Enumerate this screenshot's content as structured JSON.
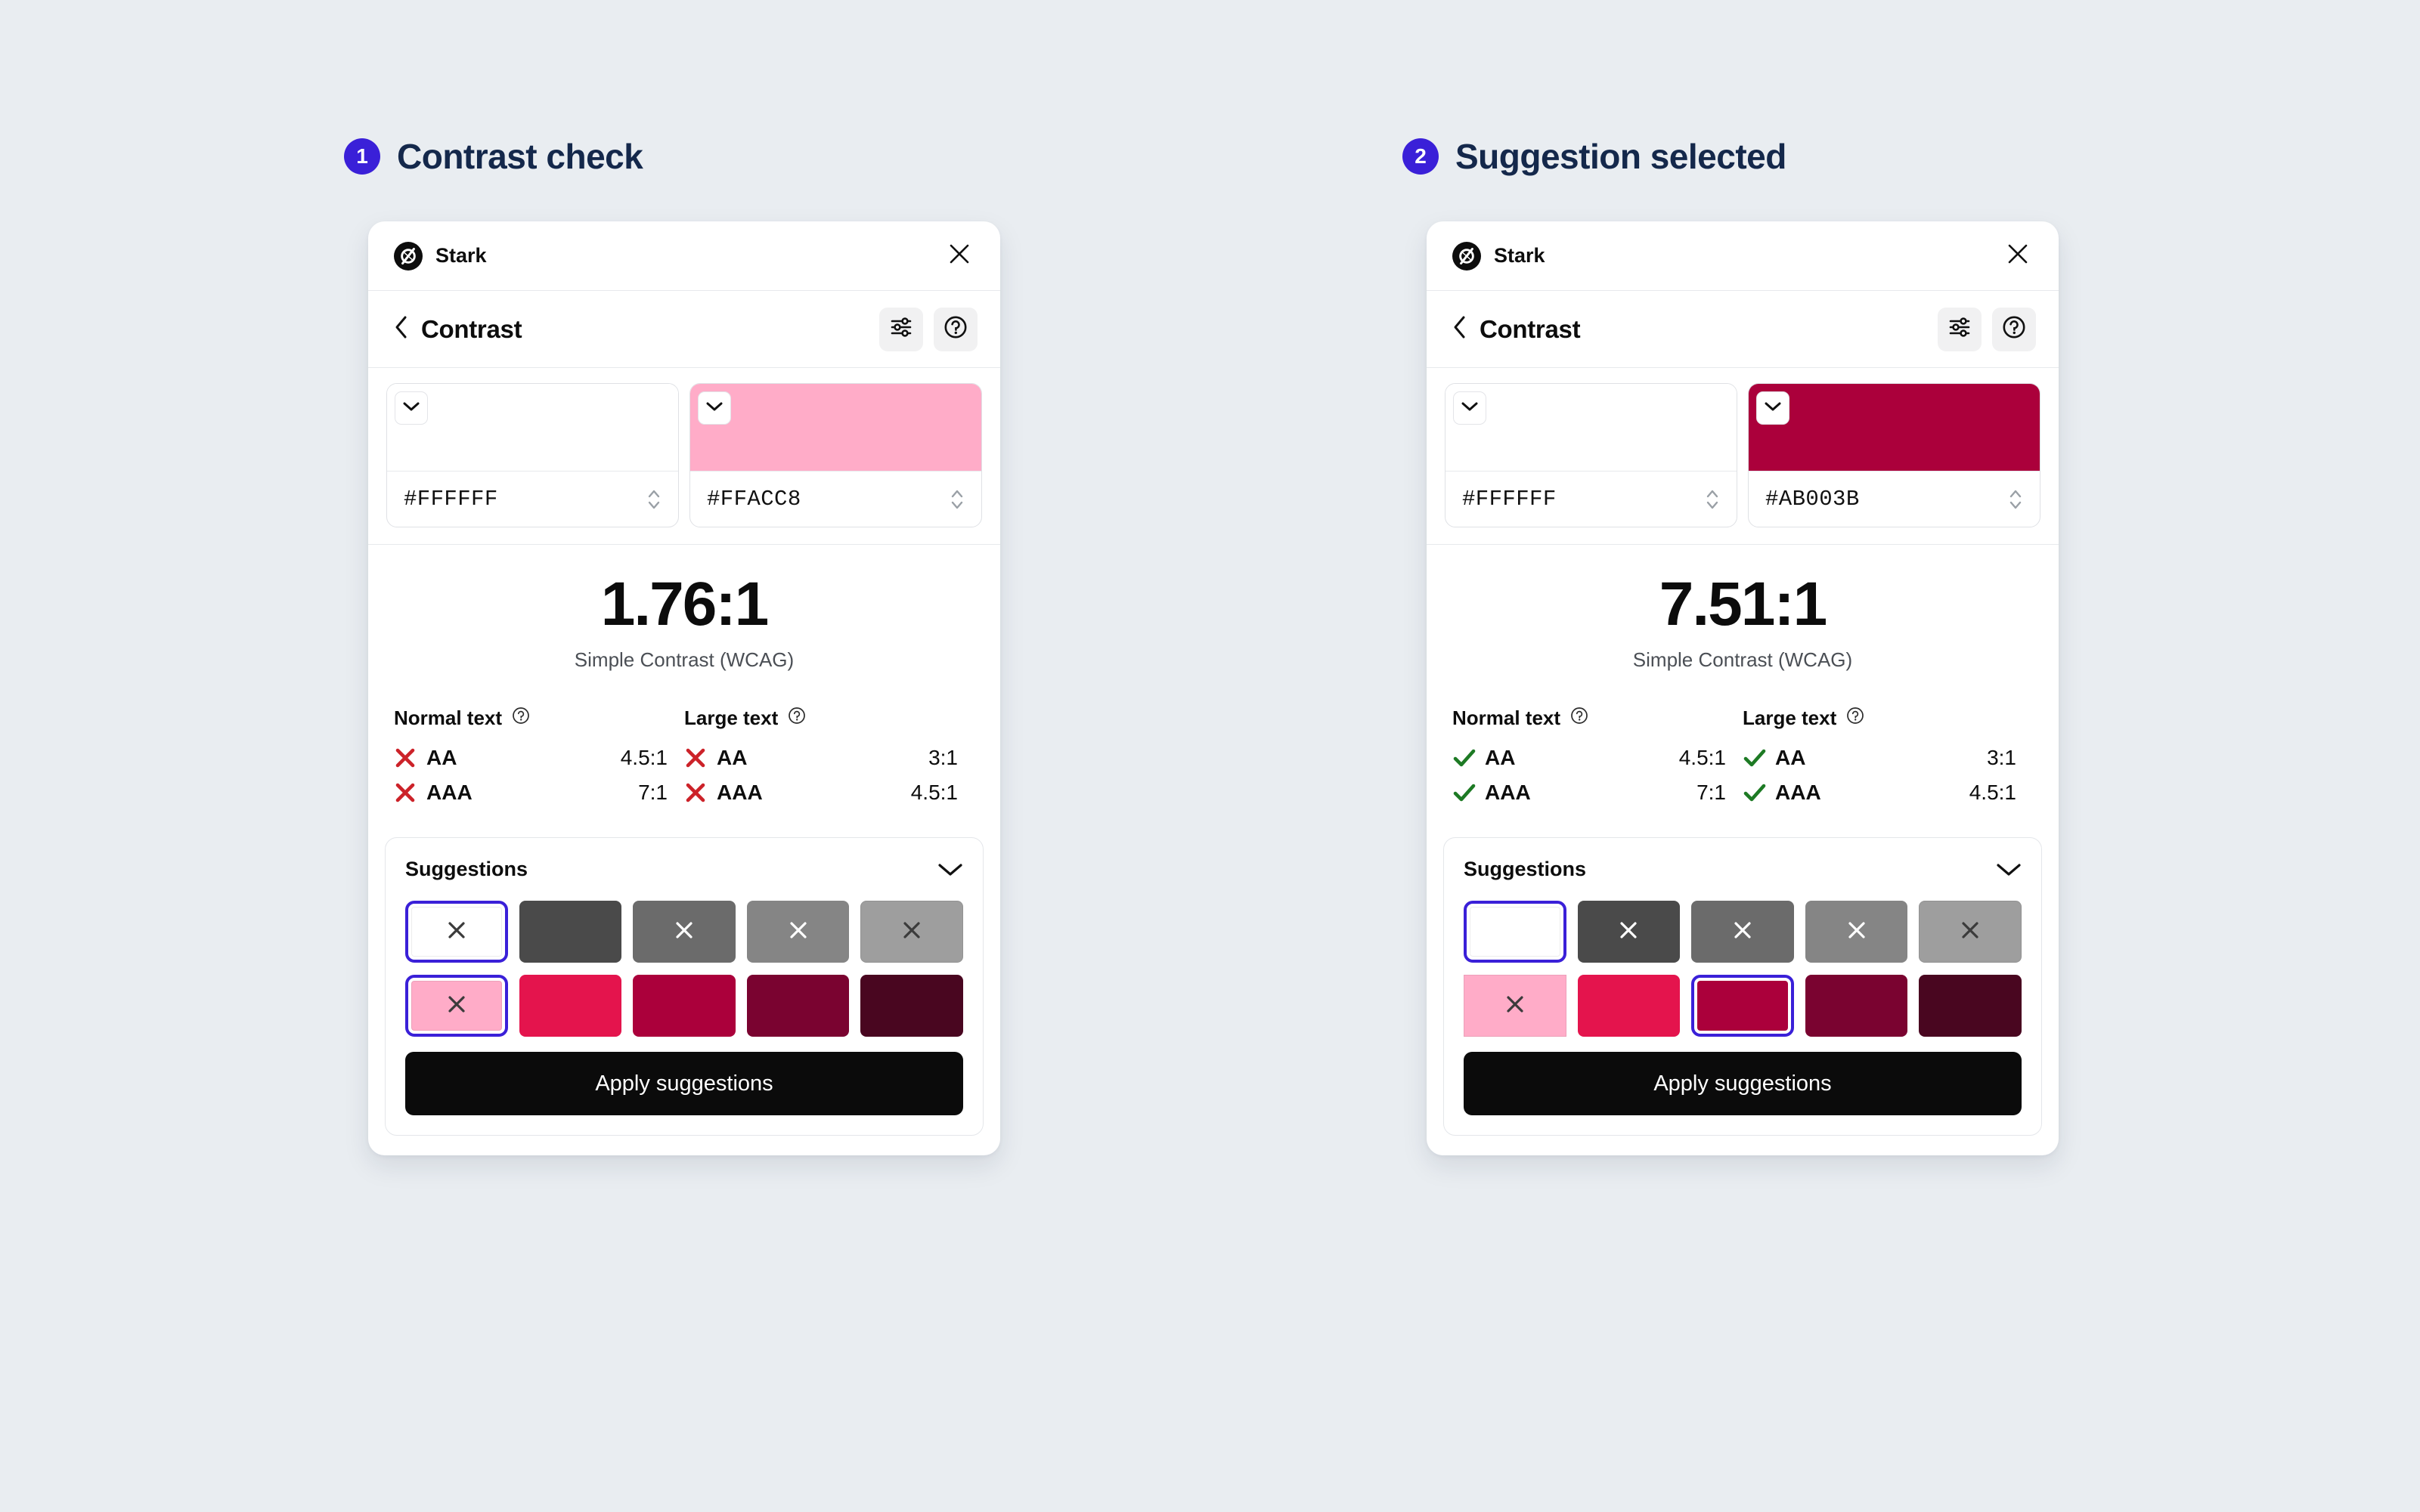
{
  "theme": {
    "page_background": "#e9edf1",
    "badge_color": "#3a20d8",
    "title_color": "#14284b",
    "selected_ring_color": "#3a20d8",
    "fail_color": "#cc2229",
    "pass_color": "#1d7a24",
    "apply_button_background": "#0b0b0b"
  },
  "steps": [
    {
      "number": "1",
      "title": "Contrast check",
      "panel": {
        "titlebar": {
          "brand": "Stark",
          "logo_icon": "stark-logo-icon",
          "close_icon": "close-icon"
        },
        "navbar": {
          "back_icon": "chevron-left-icon",
          "title": "Contrast",
          "settings_icon": "sliders-icon",
          "help_icon": "question-circle-icon"
        },
        "colors": [
          {
            "role": "foreground",
            "hex": "#FFFFFF",
            "swatch_color": "#FFFFFF",
            "dropdown_icon": "chevron-down-icon",
            "stepper_icon": "up-down-stepper-icon"
          },
          {
            "role": "background",
            "hex": "#FFACC8",
            "swatch_color": "#FFACC8",
            "dropdown_icon": "chevron-down-icon",
            "stepper_icon": "up-down-stepper-icon"
          }
        ],
        "result": {
          "ratio": "1.76:1",
          "caption": "Simple Contrast (WCAG)",
          "columns": [
            {
              "heading": "Normal text",
              "info_icon": "question-circle-icon",
              "rows": [
                {
                  "level": "AA",
                  "threshold": "4.5:1",
                  "pass": false
                },
                {
                  "level": "AAA",
                  "threshold": "7:1",
                  "pass": false
                }
              ]
            },
            {
              "heading": "Large text",
              "info_icon": "question-circle-icon",
              "rows": [
                {
                  "level": "AA",
                  "threshold": "3:1",
                  "pass": false
                },
                {
                  "level": "AAA",
                  "threshold": "4.5:1",
                  "pass": false
                }
              ]
            }
          ]
        },
        "suggestions": {
          "title": "Suggestions",
          "collapse_icon": "chevron-down-icon",
          "rows": [
            [
              {
                "color": "#FFFFFF",
                "selected": true,
                "failing": true,
                "square": false
              },
              {
                "color": "#4A4A4A",
                "selected": false,
                "failing": false,
                "square": false
              },
              {
                "color": "#6B6B6B",
                "selected": false,
                "failing": true,
                "square": false
              },
              {
                "color": "#858585",
                "selected": false,
                "failing": true,
                "square": false
              },
              {
                "color": "#9E9E9E",
                "selected": false,
                "failing": true,
                "square": false
              }
            ],
            [
              {
                "color": "#FFACC8",
                "selected": true,
                "failing": true,
                "square": false
              },
              {
                "color": "#E4144D",
                "selected": false,
                "failing": false,
                "square": false
              },
              {
                "color": "#AB003B",
                "selected": false,
                "failing": false,
                "square": false
              },
              {
                "color": "#7A0330",
                "selected": false,
                "failing": false,
                "square": false
              },
              {
                "color": "#490620",
                "selected": false,
                "failing": false,
                "square": false
              }
            ]
          ],
          "apply_label": "Apply suggestions"
        }
      }
    },
    {
      "number": "2",
      "title": "Suggestion selected",
      "panel": {
        "titlebar": {
          "brand": "Stark",
          "logo_icon": "stark-logo-icon",
          "close_icon": "close-icon"
        },
        "navbar": {
          "back_icon": "chevron-left-icon",
          "title": "Contrast",
          "settings_icon": "sliders-icon",
          "help_icon": "question-circle-icon"
        },
        "colors": [
          {
            "role": "foreground",
            "hex": "#FFFFFF",
            "swatch_color": "#FFFFFF",
            "dropdown_icon": "chevron-down-icon",
            "stepper_icon": "up-down-stepper-icon"
          },
          {
            "role": "background",
            "hex": "#AB003B",
            "swatch_color": "#AB003B",
            "dropdown_icon": "chevron-down-icon",
            "stepper_icon": "up-down-stepper-icon"
          }
        ],
        "result": {
          "ratio": "7.51:1",
          "caption": "Simple Contrast (WCAG)",
          "columns": [
            {
              "heading": "Normal text",
              "info_icon": "question-circle-icon",
              "rows": [
                {
                  "level": "AA",
                  "threshold": "4.5:1",
                  "pass": true
                },
                {
                  "level": "AAA",
                  "threshold": "7:1",
                  "pass": true
                }
              ]
            },
            {
              "heading": "Large text",
              "info_icon": "question-circle-icon",
              "rows": [
                {
                  "level": "AA",
                  "threshold": "3:1",
                  "pass": true
                },
                {
                  "level": "AAA",
                  "threshold": "4.5:1",
                  "pass": true
                }
              ]
            }
          ]
        },
        "suggestions": {
          "title": "Suggestions",
          "collapse_icon": "chevron-down-icon",
          "rows": [
            [
              {
                "color": "#FFFFFF",
                "selected": true,
                "failing": false,
                "square": false
              },
              {
                "color": "#4A4A4A",
                "selected": false,
                "failing": true,
                "square": false
              },
              {
                "color": "#6B6B6B",
                "selected": false,
                "failing": true,
                "square": false
              },
              {
                "color": "#858585",
                "selected": false,
                "failing": true,
                "square": false
              },
              {
                "color": "#9E9E9E",
                "selected": false,
                "failing": true,
                "square": false
              }
            ],
            [
              {
                "color": "#FFACC8",
                "selected": false,
                "failing": true,
                "square": true
              },
              {
                "color": "#E4144D",
                "selected": false,
                "failing": false,
                "square": false
              },
              {
                "color": "#AB003B",
                "selected": true,
                "failing": false,
                "square": false
              },
              {
                "color": "#7A0330",
                "selected": false,
                "failing": false,
                "square": false
              },
              {
                "color": "#490620",
                "selected": false,
                "failing": false,
                "square": false
              }
            ]
          ],
          "apply_label": "Apply suggestions"
        }
      }
    }
  ]
}
